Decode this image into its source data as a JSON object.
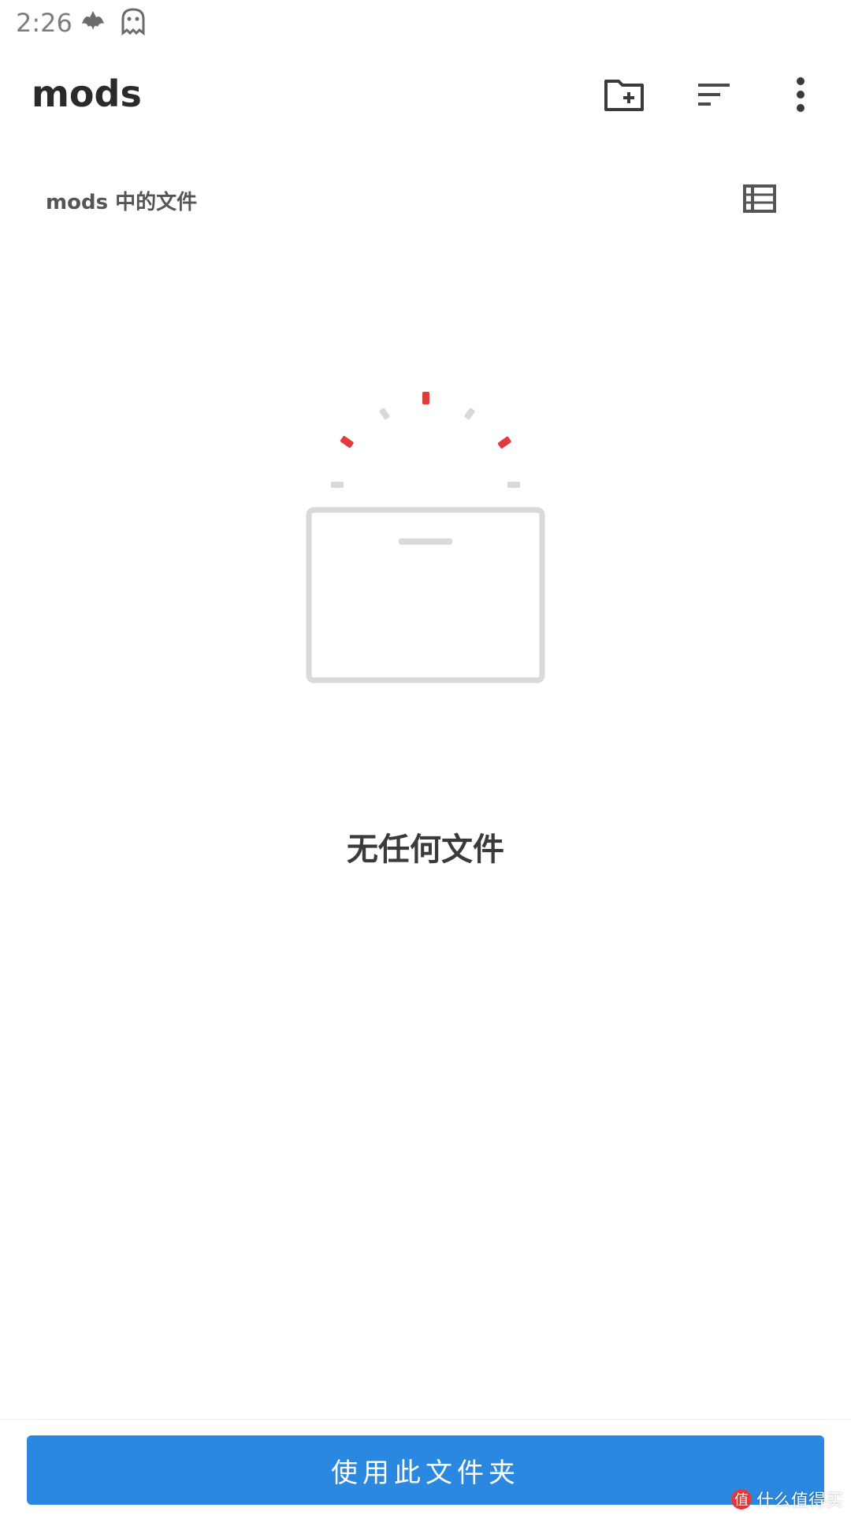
{
  "status_bar": {
    "time": "2:26",
    "icons": [
      "bat-icon",
      "ghost-icon"
    ]
  },
  "app_bar": {
    "title": "mods",
    "actions": [
      "new-folder-icon",
      "sort-icon",
      "more-vert-icon"
    ]
  },
  "section": {
    "title": "mods 中的文件",
    "view_toggle_icon": "list-view-icon"
  },
  "empty_state": {
    "message": "无任何文件",
    "illustration": "empty-folder-icon"
  },
  "bottom": {
    "primary_button_label": "使用此文件夹"
  },
  "watermark": {
    "badge": "值",
    "text": "什么值得买"
  },
  "colors": {
    "accent": "#2a88e0",
    "illustration_red": "#e23b3b",
    "illustration_gray": "#d9d9dc"
  }
}
